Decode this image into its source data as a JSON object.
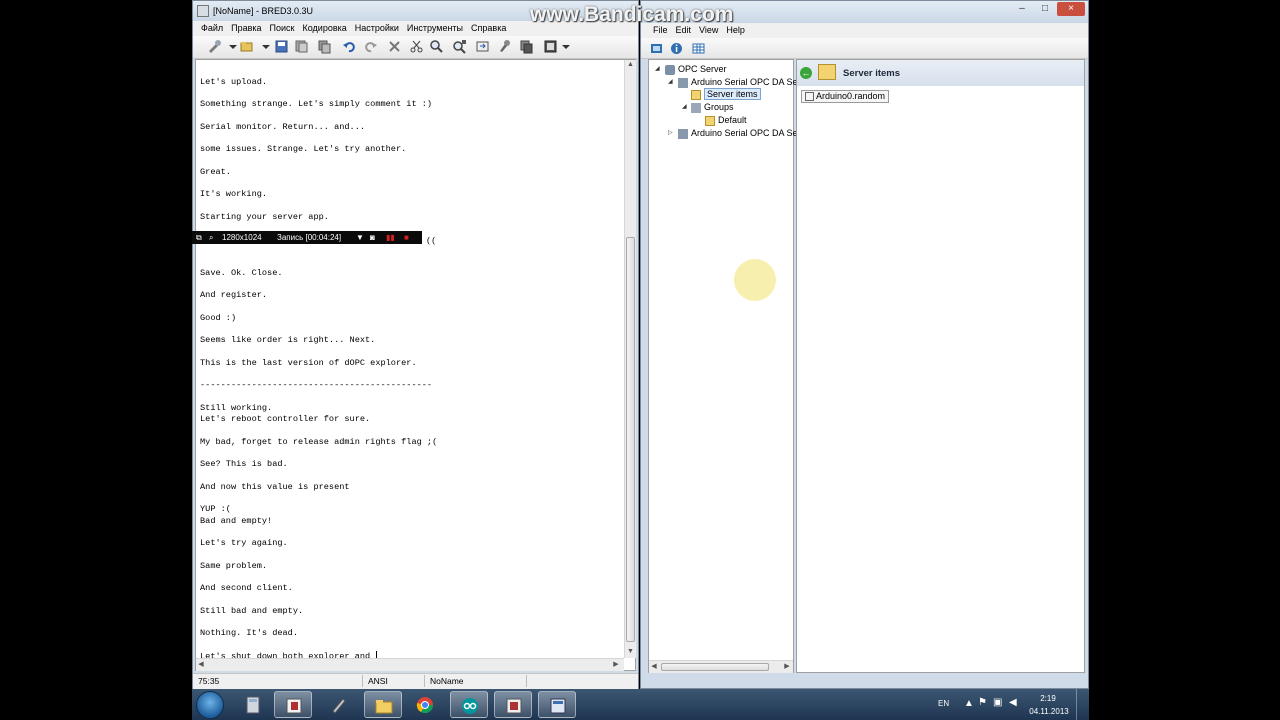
{
  "watermark": "www.Bandicam.com",
  "editor": {
    "title": "[NoName] - BRED3.0.3U",
    "menu": [
      "Файл",
      "Правка",
      "Поиск",
      "Кодировка",
      "Настройки",
      "Инструменты",
      "Справка"
    ],
    "toolbar_icons": [
      "tools-icon",
      "open-icon",
      "open-dropdown-icon",
      "save-icon",
      "save-as-icon",
      "copy-icon",
      "undo-icon",
      "redo-icon",
      "clear-icon",
      "cut-icon",
      "find-icon",
      "find-replace-icon",
      "goto-icon",
      "settings-icon",
      "copy-file-icon",
      "export-icon",
      "more-dropdown-icon"
    ],
    "lines": [
      {
        "text": "Let's upload.",
        "row": 0
      },
      {
        "text": "Something strange. Let's simply comment it :)",
        "row": 1
      },
      {
        "text": "Serial monitor. Return... and...",
        "row": 2
      },
      {
        "text": "some issues. Strange. Let's try another.",
        "row": 3
      },
      {
        "text": "Great.",
        "row": 4
      },
      {
        "text": "It's working.",
        "row": 5
      },
      {
        "text": "Starting your server app.",
        "row": 6
      },
      {
        "text": "((",
        "row": 7
      },
      {
        "text": "Save. Ok. Close.",
        "row": 8
      },
      {
        "text": "And register.",
        "row": 9
      },
      {
        "text": "Good :)",
        "row": 10
      },
      {
        "text": "Seems like order is right... Next.",
        "row": 11
      },
      {
        "text": "This is the last version of dOPC explorer.",
        "row": 12
      },
      {
        "text": "---------------------------------------------",
        "row": 13
      },
      {
        "text": "Still working.",
        "row": 14
      },
      {
        "text": "Let's reboot controller for sure.",
        "row": 15
      },
      {
        "text": "My bad, forget to release admin rights flag ;(",
        "row": 16
      },
      {
        "text": "See? This is bad.",
        "row": 17
      },
      {
        "text": "And now this value is present",
        "row": 18
      },
      {
        "text": "YUP :(",
        "row": 19
      },
      {
        "text": "Bad and empty!",
        "row": 20
      },
      {
        "text": "Let's try againg.",
        "row": 21
      },
      {
        "text": "Same problem.",
        "row": 22
      },
      {
        "text": "And second client.",
        "row": 23
      },
      {
        "text": "Still bad and empty.",
        "row": 24
      },
      {
        "text": "Nothing. It's dead.",
        "row": 25
      },
      {
        "text": "Let's shut down both explorer and ",
        "row": 26
      }
    ],
    "status": {
      "position": "75:35",
      "encoding": "ANSI",
      "filename": "NoName"
    }
  },
  "recorder": {
    "resolution": "1280x1024",
    "record_label": "Запись [00:04:24]"
  },
  "opc": {
    "menu": [
      "File",
      "Edit",
      "View",
      "Help"
    ],
    "tree": {
      "root": "OPC Server",
      "server1": "Arduino Serial OPC DA Se",
      "server_items": "Server items",
      "groups": "Groups",
      "default_group": "Default",
      "server2": "Arduino Serial OPC DA Se"
    },
    "pane_title": "Server items",
    "items": [
      "Arduino0.random"
    ]
  },
  "taskbar": {
    "apps": [
      "calculator-icon",
      "notebook-icon",
      "pen-icon",
      "explorer-folder-icon",
      "chrome-icon",
      "arduino-icon",
      "editor-icon",
      "opc-explorer-icon"
    ],
    "language": "EN",
    "time": "2:19",
    "date": "04.11.2013"
  }
}
